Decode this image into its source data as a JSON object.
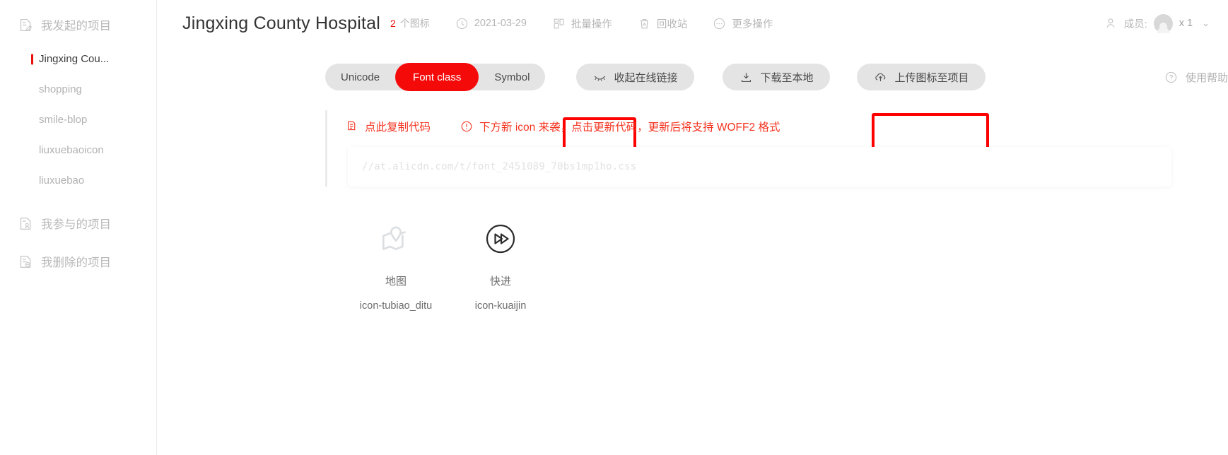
{
  "sidebar": {
    "groups": [
      {
        "label": "我发起的项目",
        "icon": "doc-edit-icon"
      },
      {
        "label": "我参与的项目",
        "icon": "doc-user-icon"
      },
      {
        "label": "我删除的项目",
        "icon": "doc-delete-icon"
      }
    ],
    "projects": [
      {
        "label": "Jingxing Cou...",
        "active": true
      },
      {
        "label": "shopping",
        "active": false
      },
      {
        "label": "smile-blop",
        "active": false
      },
      {
        "label": "liuxuebaoicon",
        "active": false
      },
      {
        "label": "liuxuebao",
        "active": false
      }
    ]
  },
  "header": {
    "title": "Jingxing County Hospital",
    "icon_count": "2",
    "icon_count_unit": "个图标",
    "date": "2021-03-29",
    "date_icon": "clock-icon",
    "batch_label": "批量操作",
    "batch_icon": "batch-icon",
    "recycle_label": "回收站",
    "recycle_icon": "trash-icon",
    "more_label": "更多操作",
    "more_icon": "ellipsis-circle-icon",
    "members_label": "成员:",
    "members_icon": "users-icon",
    "members_count": "x 1",
    "caret_icon": "chevron-down-icon"
  },
  "toolbar": {
    "tabs": [
      {
        "label": "Unicode",
        "active": false
      },
      {
        "label": "Font class",
        "active": true
      },
      {
        "label": "Symbol",
        "active": false
      }
    ],
    "collapse_link_label": "收起在线链接",
    "collapse_link_icon": "eye-closed-icon",
    "download_label": "下载至本地",
    "download_icon": "download-icon",
    "upload_label": "上传图标至项目",
    "upload_icon": "cloud-upload-icon",
    "help_label": "使用帮助",
    "help_icon": "question-circle-icon"
  },
  "notice": {
    "copy_label": "点此复制代码",
    "copy_icon": "copy-icon",
    "new_icon_label": "下方新 icon 来袭，点击更新代码，更新后将支持 WOFF2 格式",
    "warn_icon": "exclamation-circle-icon"
  },
  "code": {
    "url": "//at.alicdn.com/t/font_2451089_70bs1mp1ho.css"
  },
  "icons": [
    {
      "name_cn": "地图",
      "class_name": "icon-tubiao_ditu",
      "glyph": "map-pin-icon"
    },
    {
      "name_cn": "快进",
      "class_name": "icon-kuaijin",
      "glyph": "fast-forward-circle-icon"
    }
  ],
  "colors": {
    "accent_red": "#f50a0a",
    "annotation_red": "#fe0000",
    "notice_red": "#f4331f",
    "pill_gray": "#e4e4e4"
  }
}
